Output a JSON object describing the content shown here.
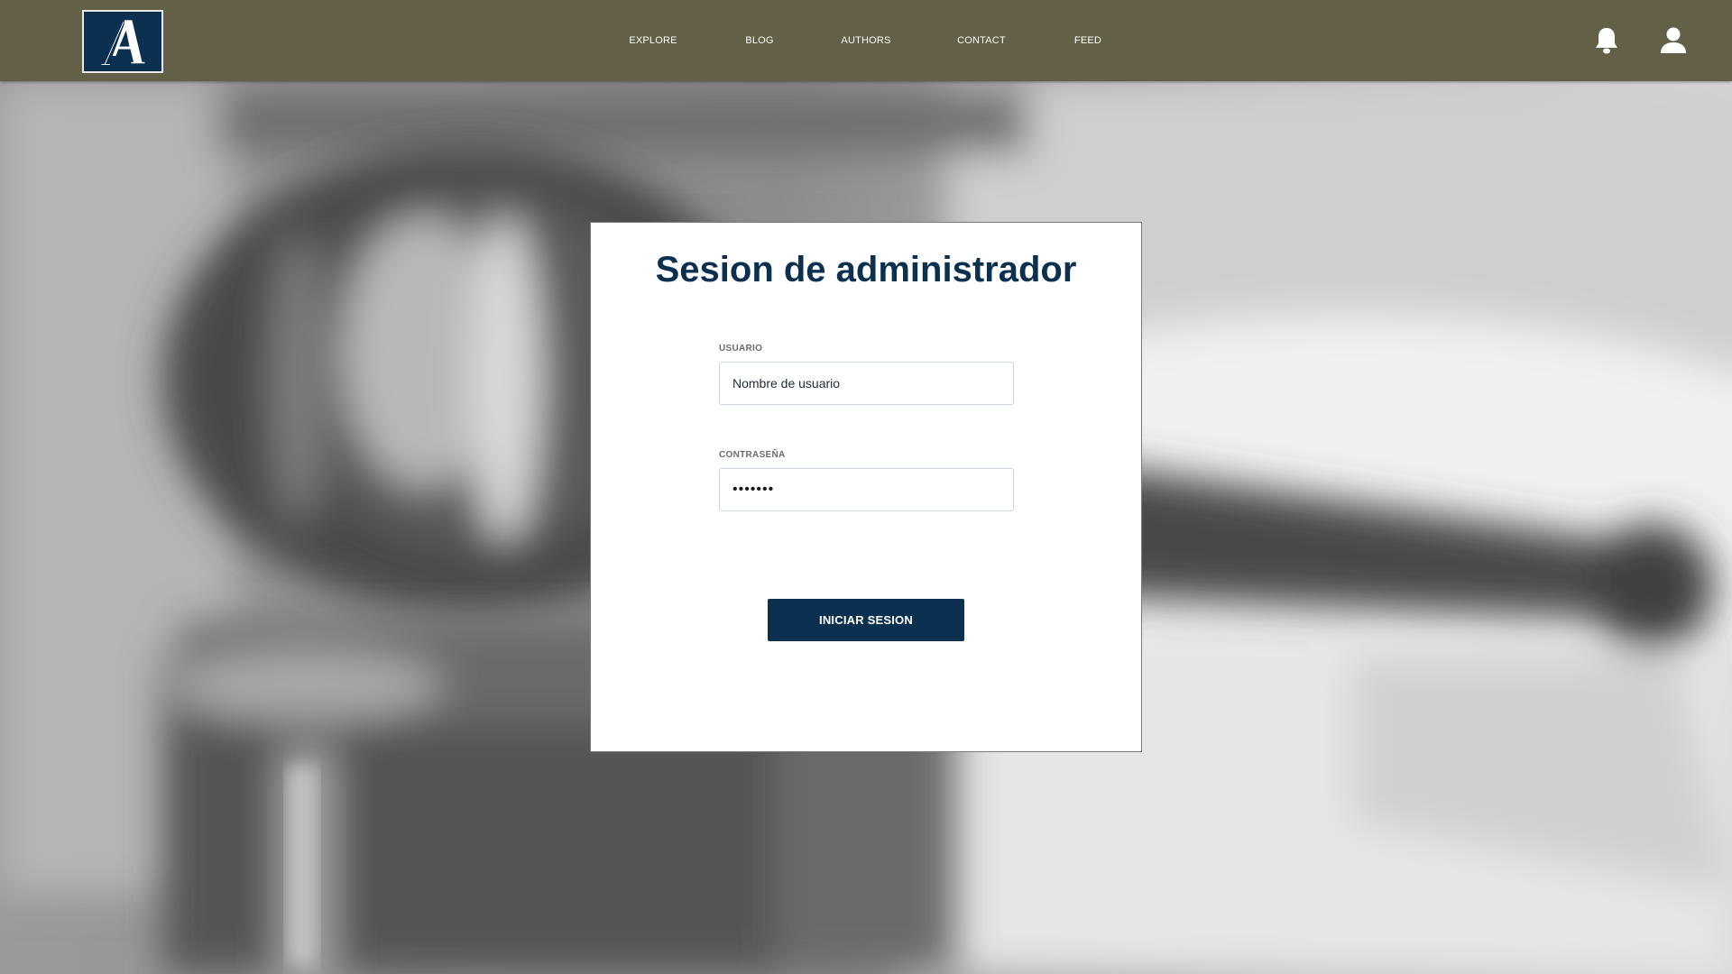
{
  "header": {
    "brand_letter": "A",
    "background_color": "#646047",
    "nav": [
      {
        "label": "EXPLORE"
      },
      {
        "label": "BLOG"
      },
      {
        "label": "AUTHORS"
      },
      {
        "label": "CONTACT"
      },
      {
        "label": "FEED"
      }
    ],
    "icons": [
      "bell-icon",
      "user-icon"
    ]
  },
  "login": {
    "title": "Sesion de administrador",
    "username": {
      "label": "USUARIO",
      "value": "Nombre de usuario"
    },
    "password": {
      "label": "CONTRASEÑA",
      "value": "•••••••"
    },
    "submit_label": "INICIAR SESION"
  },
  "colors": {
    "primary": "#0c3050",
    "header": "#646047",
    "card": "#ffffff"
  }
}
